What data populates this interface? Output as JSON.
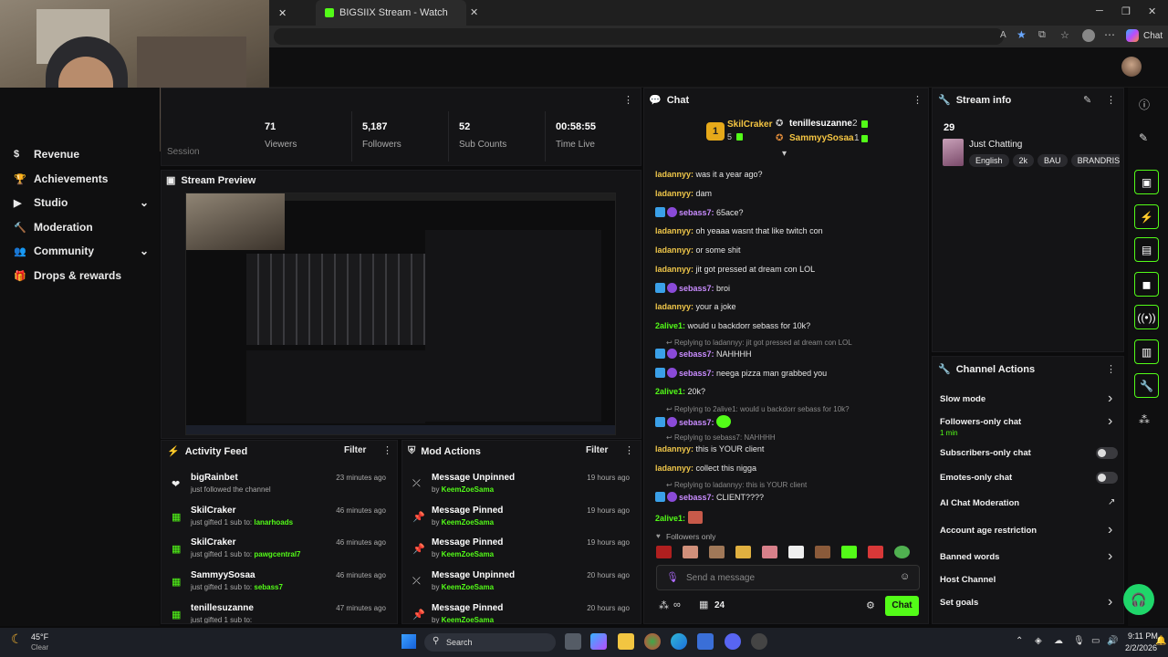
{
  "browser": {
    "tab_title": "BIGSIIX Stream - Watch Live on Ki",
    "copilot_label": "Chat"
  },
  "nav": {
    "items": [
      {
        "label": "Revenue",
        "has_chevron": false
      },
      {
        "label": "Achievements",
        "has_chevron": false
      },
      {
        "label": "Studio",
        "has_chevron": true
      },
      {
        "label": "Moderation",
        "has_chevron": false
      },
      {
        "label": "Community",
        "has_chevron": true
      },
      {
        "label": "Drops & rewards",
        "has_chevron": false
      }
    ]
  },
  "stats": {
    "session_label": "Session",
    "items": [
      {
        "value": "71",
        "label": "Viewers"
      },
      {
        "value": "5,187",
        "label": "Followers"
      },
      {
        "value": "52",
        "label": "Sub Counts"
      },
      {
        "value": "00:58:55",
        "label": "Time Live"
      }
    ]
  },
  "preview": {
    "title": "Stream Preview"
  },
  "activity": {
    "title": "Activity Feed",
    "filter": "Filter",
    "rows": [
      {
        "name": "bigRainbet",
        "detail_pre": "just followed the channel",
        "detail_hl": "",
        "time": "23 minutes ago",
        "icon": "heart-icon"
      },
      {
        "name": "SkilCraker",
        "detail_pre": "just gifted 1 sub to: ",
        "detail_hl": "lanarhoads",
        "time": "46 minutes ago",
        "icon": "gift-icon"
      },
      {
        "name": "SkilCraker",
        "detail_pre": "just gifted 1 sub to: ",
        "detail_hl": "pawgcentral7",
        "time": "46 minutes ago",
        "icon": "gift-icon"
      },
      {
        "name": "SammyySosaa",
        "detail_pre": "just gifted 1 sub to: ",
        "detail_hl": "sebass7",
        "time": "46 minutes ago",
        "icon": "gift-icon"
      },
      {
        "name": "tenillesuzanne",
        "detail_pre": "just gifted 1 sub to: ",
        "detail_hl": "",
        "time": "47 minutes ago",
        "icon": "gift-icon"
      }
    ]
  },
  "mod": {
    "title": "Mod Actions",
    "filter": "Filter",
    "rows": [
      {
        "name": "Message Unpinned",
        "detail_pre": "by ",
        "detail_hl": "KeemZoeSama",
        "time": "19 hours ago",
        "icon": "unpin-icon"
      },
      {
        "name": "Message Pinned",
        "detail_pre": "by ",
        "detail_hl": "KeemZoeSama",
        "time": "19 hours ago",
        "icon": "pin-icon"
      },
      {
        "name": "Message Pinned",
        "detail_pre": "by ",
        "detail_hl": "KeemZoeSama",
        "time": "19 hours ago",
        "icon": "pin-icon"
      },
      {
        "name": "Message Unpinned",
        "detail_pre": "by ",
        "detail_hl": "KeemZoeSama",
        "time": "20 hours ago",
        "icon": "unpin-icon"
      },
      {
        "name": "Message Pinned",
        "detail_pre": "by ",
        "detail_hl": "KeemZoeSama",
        "time": "20 hours ago",
        "icon": "pin-icon"
      }
    ]
  },
  "chat": {
    "title": "Chat",
    "top": {
      "first_name": "SkilCraker",
      "first_count": "5",
      "second_name": "tenillesuzanne",
      "second_count": "2",
      "third_name": "SammyySosaa",
      "third_count": "1",
      "rank": "1"
    },
    "messages": [
      {
        "type": "msg",
        "user": "ladannyy",
        "color": "#f0c74a",
        "text": "was it a year ago?",
        "badges": false
      },
      {
        "type": "msg",
        "user": "ladannyy",
        "color": "#f0c74a",
        "text": "dam",
        "badges": false
      },
      {
        "type": "msg",
        "user": "sebass7",
        "color": "#c98cff",
        "text": "65ace?",
        "badges": true
      },
      {
        "type": "msg",
        "user": "ladannyy",
        "color": "#f0c74a",
        "text": "oh yeaaa wasnt that like twitch con",
        "badges": false
      },
      {
        "type": "msg",
        "user": "ladannyy",
        "color": "#f0c74a",
        "text": "or some shit",
        "badges": false
      },
      {
        "type": "msg",
        "user": "ladannyy",
        "color": "#f0c74a",
        "text": "jit got pressed at dream con LOL",
        "badges": false
      },
      {
        "type": "msg",
        "user": "sebass7",
        "color": "#c98cff",
        "text": "broi",
        "badges": true
      },
      {
        "type": "msg",
        "user": "ladannyy",
        "color": "#f0c74a",
        "text": "your a joke",
        "badges": false
      },
      {
        "type": "msg",
        "user": "2alive1",
        "color": "#53fc18",
        "text": "would u backdorr sebass for 10k?",
        "badges": false
      },
      {
        "type": "reply",
        "text": "Replying to ladannyy: jit got pressed at dream con LOL"
      },
      {
        "type": "msg",
        "user": "sebass7",
        "color": "#c98cff",
        "text": "NAHHHH",
        "badges": true
      },
      {
        "type": "msg",
        "user": "sebass7",
        "color": "#c98cff",
        "text": "neega pizza man grabbed you",
        "badges": true
      },
      {
        "type": "msg",
        "user": "2alive1",
        "color": "#53fc18",
        "text": "20k?",
        "badges": false
      },
      {
        "type": "reply",
        "text": "Replying to 2alive1: would u backdorr sebass for 10k?"
      },
      {
        "type": "msg",
        "user": "sebass7",
        "color": "#c98cff",
        "text": "",
        "badges": true,
        "emote": true
      },
      {
        "type": "reply",
        "text": "Replying to sebass7: NAHHHH"
      },
      {
        "type": "msg",
        "user": "ladannyy",
        "color": "#f0c74a",
        "text": "this is YOUR client",
        "badges": false
      },
      {
        "type": "msg",
        "user": "ladannyy",
        "color": "#f0c74a",
        "text": "collect this nigga",
        "badges": false
      },
      {
        "type": "reply",
        "text": "Replying to ladannyy: this is YOUR client"
      },
      {
        "type": "msg",
        "user": "sebass7",
        "color": "#c98cff",
        "text": "CLIENT????",
        "badges": true
      },
      {
        "type": "msg",
        "user": "2alive1",
        "color": "#53fc18",
        "text": "",
        "badges": false,
        "emote": true
      }
    ],
    "followers_only": "Followers only",
    "input_placeholder": "Send a message",
    "count": "24",
    "send_label": "Chat"
  },
  "stream_info": {
    "title": "Stream info",
    "viewers": "29",
    "category": "Just Chatting",
    "tags": [
      "English",
      "2k",
      "BAU",
      "BRANDRIS"
    ]
  },
  "channel_actions": {
    "title": "Channel Actions",
    "items": [
      {
        "label": "Slow mode",
        "kind": "arrow"
      },
      {
        "label": "Followers-only chat",
        "kind": "arrow",
        "sub": "1 min"
      },
      {
        "label": "Subscribers-only chat",
        "kind": "toggle"
      },
      {
        "label": "Emotes-only chat",
        "kind": "toggle"
      },
      {
        "label": "AI Chat Moderation",
        "kind": "external"
      },
      {
        "label": "Account age restriction",
        "kind": "arrow"
      },
      {
        "label": "Banned words",
        "kind": "arrow"
      },
      {
        "label": "Host Channel",
        "kind": "none"
      },
      {
        "label": "Set goals",
        "kind": "arrow"
      }
    ]
  },
  "taskbar": {
    "temp": "45°F",
    "weather": "Clear",
    "search": "Search",
    "time": "9:11 PM",
    "date": "2/2/2026"
  },
  "colors": {
    "accent": "#53fc18",
    "panel": "#141416",
    "bg": "#0b0b0c"
  }
}
